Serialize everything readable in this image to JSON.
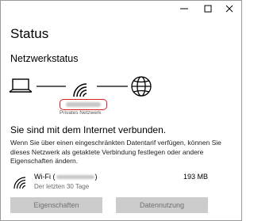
{
  "window": {
    "controls": [
      "minimize",
      "maximize",
      "close"
    ]
  },
  "page": {
    "title": "Status",
    "section_title": "Netzwerkstatus"
  },
  "diagram": {
    "nodes": [
      "laptop-icon",
      "wifi-icon",
      "globe-icon"
    ],
    "network_type": "Privates Netzwerk"
  },
  "status": {
    "connected_text": "Sie sind mit dem Internet verbunden.",
    "description": "Wenn Sie über einen eingeschränkten Datentarif verfügen, können Sie dieses Netzwerk als getaktete Verbindung festlegen oder andere Eigenschaften ändern."
  },
  "connection": {
    "name_prefix": "Wi-Fi (",
    "name_suffix": ")",
    "period": "Der letzten 30 Tage",
    "usage": "193 MB"
  },
  "buttons": {
    "properties": "Eigenschaften",
    "data_usage": "Datennutzung"
  },
  "colors": {
    "highlight": "#e02020",
    "button_bg": "#cccccc",
    "button_text": "#707070"
  }
}
